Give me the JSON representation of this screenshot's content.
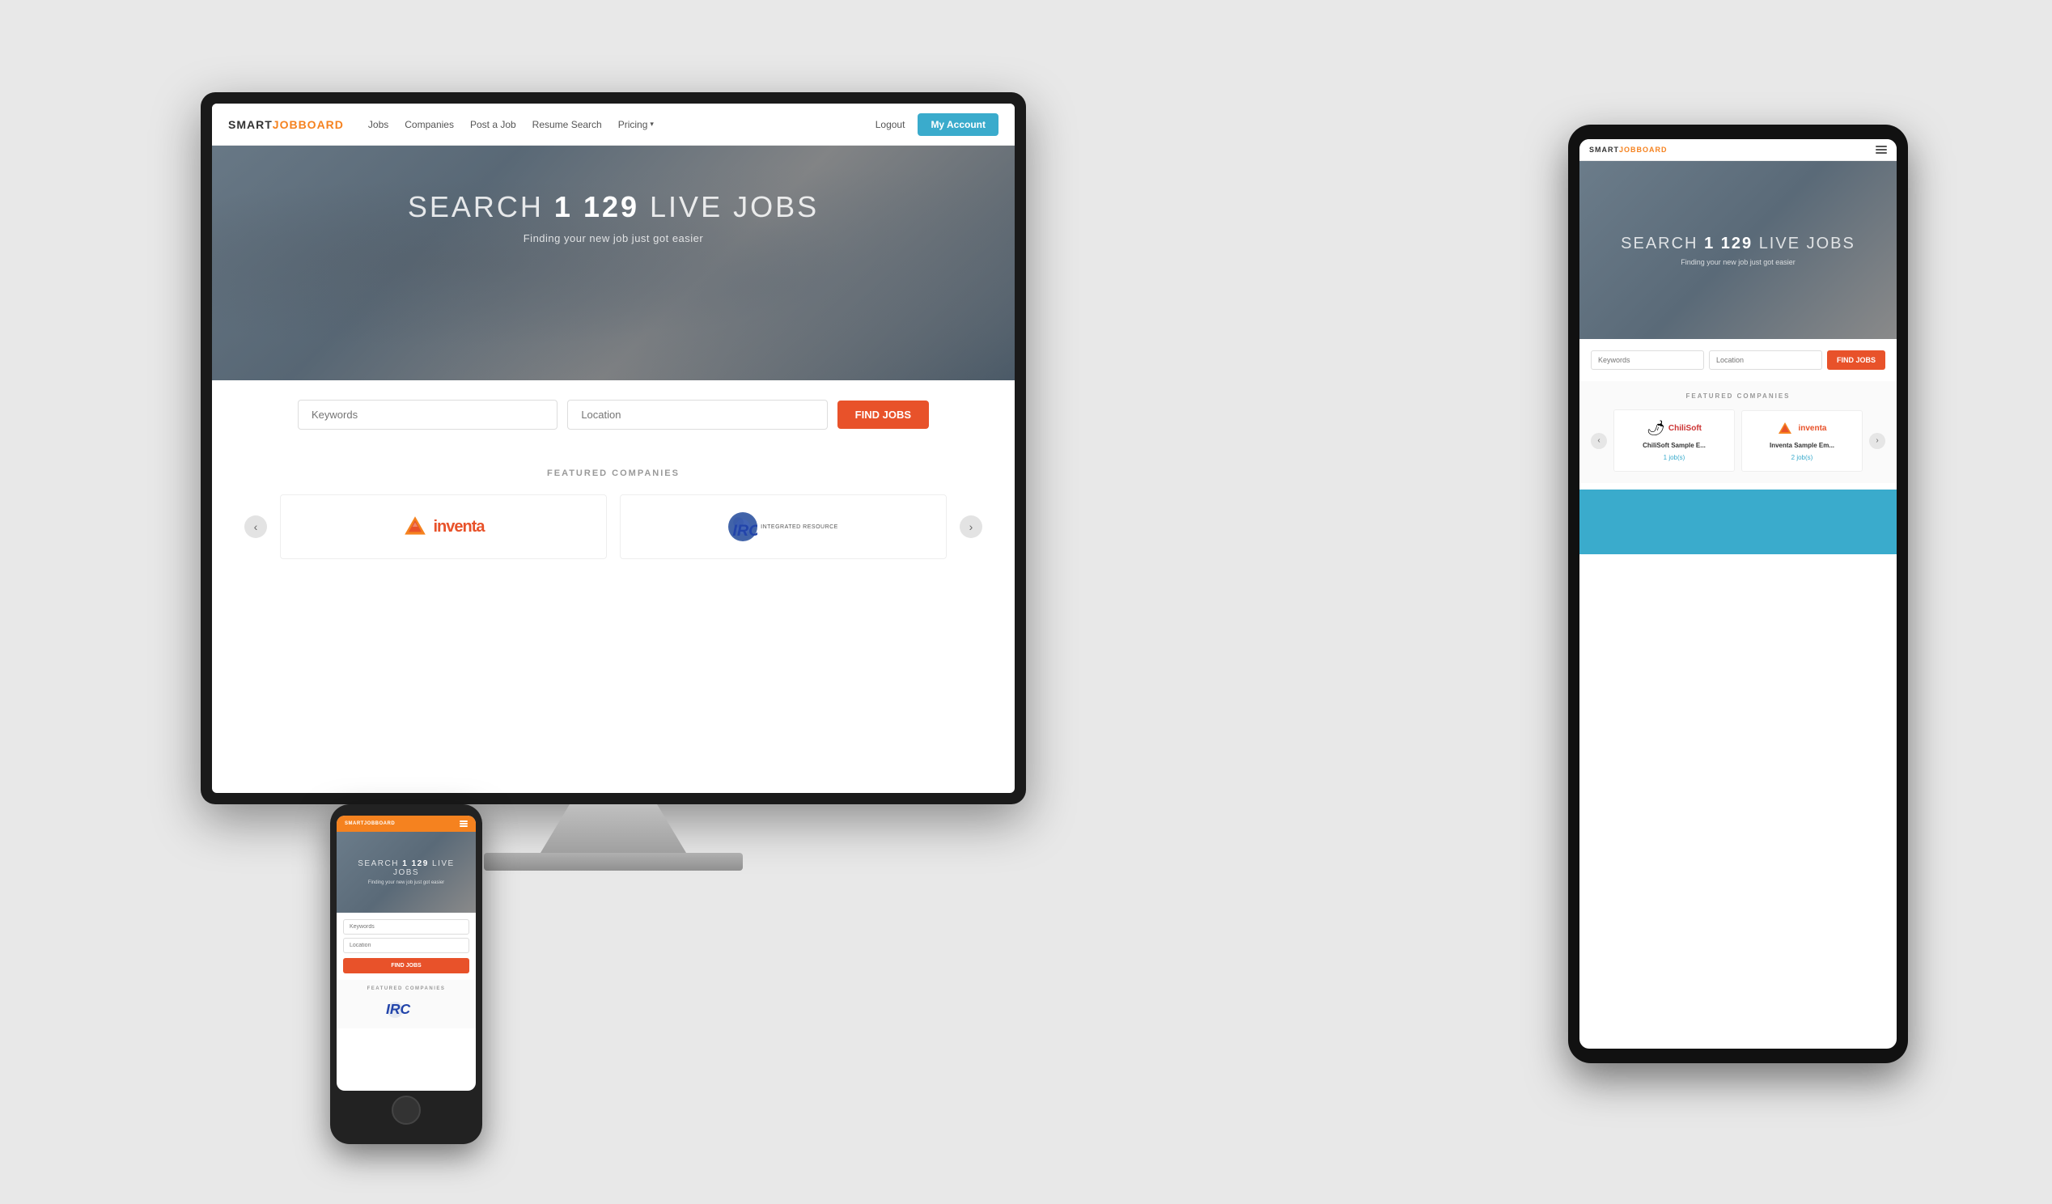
{
  "brand": {
    "smart": "SMART",
    "jobboard": "JOBBOARD"
  },
  "nav": {
    "jobs": "Jobs",
    "companies": "Companies",
    "post_a_job": "Post a Job",
    "resume_search": "Resume Search",
    "pricing": "Pricing",
    "logout": "Logout",
    "my_account": "My Account"
  },
  "hero": {
    "pre_title": "SEARCH",
    "count": "1 129",
    "post_title": "LIVE JOBS",
    "subtitle": "Finding your new job just got easier"
  },
  "search": {
    "keywords_placeholder": "Keywords",
    "location_placeholder": "Location",
    "button_label": "FIND JOBS"
  },
  "featured": {
    "section_title": "FEATURED COMPANIES",
    "companies": [
      {
        "name": "Inventa",
        "jobs_label": "inventa"
      },
      {
        "name": "IRC",
        "jobs_label": "IRC"
      }
    ]
  },
  "tablet": {
    "featured_companies": [
      {
        "name": "ChiliSoft Sample E...",
        "jobs": "1 job(s)"
      },
      {
        "name": "Inventa Sample Em...",
        "jobs": "2 job(s)"
      }
    ]
  },
  "icons": {
    "chevron_down": "▾",
    "arrow_left": "‹",
    "arrow_right": "›",
    "menu": "≡"
  }
}
